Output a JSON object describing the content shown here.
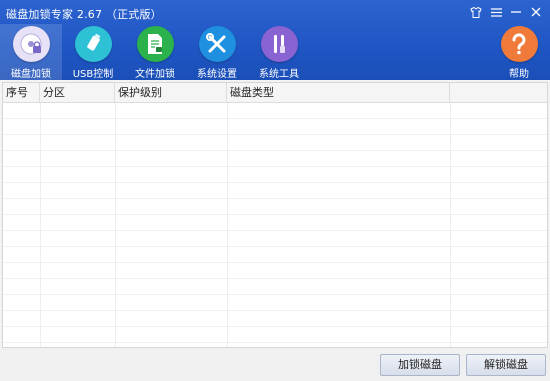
{
  "window": {
    "title": "磁盘加锁专家 2.67 （正式版）",
    "controls": [
      {
        "name": "skin-icon",
        "glyph": "👕"
      },
      {
        "name": "menu-icon",
        "glyph": "☰"
      },
      {
        "name": "minimize-icon",
        "glyph": "—"
      },
      {
        "name": "close-icon",
        "glyph": "✕"
      }
    ]
  },
  "toolbar": {
    "items": [
      {
        "label": "磁盘加锁",
        "icon": "disk-lock-icon",
        "color": "#e9e4f8",
        "active": true
      },
      {
        "label": "USB控制",
        "icon": "usb-icon",
        "color": "#2ec1d6",
        "active": false
      },
      {
        "label": "文件加锁",
        "icon": "file-lock-icon",
        "color": "#2bb24c",
        "active": false
      },
      {
        "label": "系统设置",
        "icon": "tools-icon",
        "color": "#1f8fe0",
        "active": false
      },
      {
        "label": "系统工具",
        "icon": "screwdriver-icon",
        "color": "#8a63d2",
        "active": false
      }
    ],
    "help": {
      "label": "帮助",
      "icon": "help-icon",
      "color": "#f07a3a"
    }
  },
  "table": {
    "columns": [
      "序号",
      "分区",
      "保护级别",
      "磁盘类型",
      ""
    ],
    "rows": []
  },
  "footer": {
    "lock_button": "加锁磁盘",
    "unlock_button": "解锁磁盘"
  },
  "colors": {
    "titlebar": "#2258c6",
    "background": "#f3f3f3"
  }
}
